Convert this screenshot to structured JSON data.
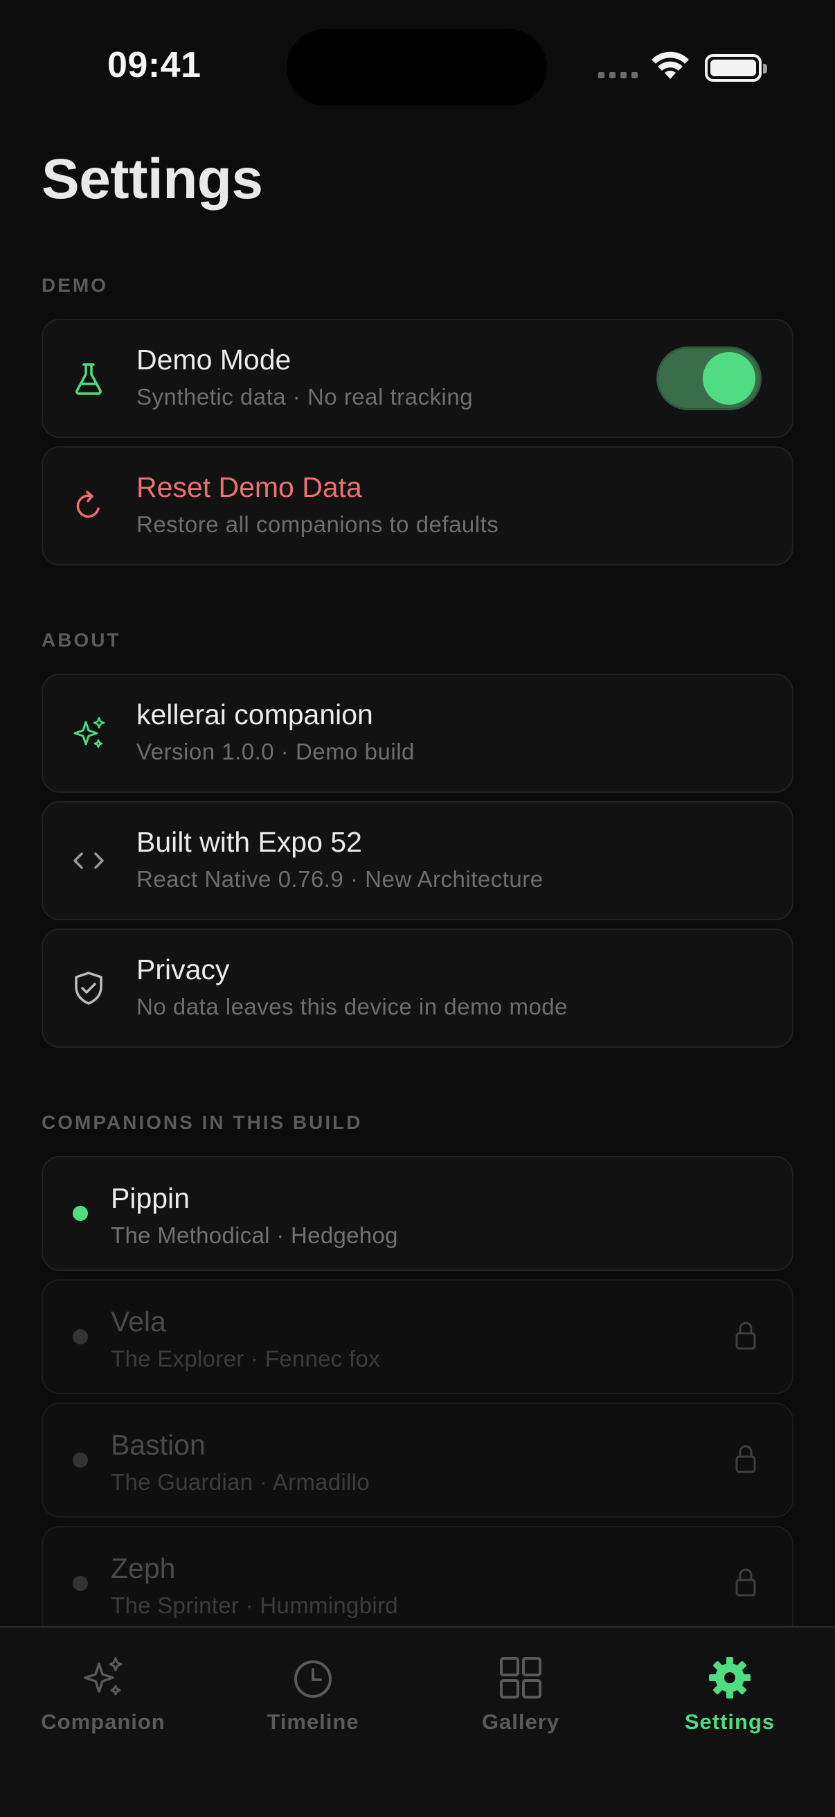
{
  "status_bar": {
    "time": "09:41"
  },
  "page": {
    "title": "Settings"
  },
  "sections": {
    "demo": "DEMO",
    "about": "ABOUT",
    "companions": "COMPANIONS IN THIS BUILD"
  },
  "demo": {
    "demo_mode": {
      "title": "Demo Mode",
      "subtitle": "Synthetic data · No real tracking",
      "icon": "flask-icon",
      "enabled": true
    },
    "reset": {
      "title": "Reset Demo Data",
      "subtitle": "Restore all companions to defaults",
      "icon": "refresh-icon"
    }
  },
  "about": {
    "app": {
      "title": "kellerai companion",
      "subtitle": "Version 1.0.0 · Demo build",
      "icon": "sparkles-icon"
    },
    "built": {
      "title": "Built with Expo 52",
      "subtitle": "React Native 0.76.9 · New Architecture",
      "icon": "code-icon"
    },
    "privacy": {
      "title": "Privacy",
      "subtitle": "No data leaves this device in demo mode",
      "icon": "shield-check-icon"
    }
  },
  "companions": [
    {
      "name": "Pippin",
      "desc": "The Methodical · Hedgehog",
      "locked": false
    },
    {
      "name": "Vela",
      "desc": "The Explorer · Fennec fox",
      "locked": true
    },
    {
      "name": "Bastion",
      "desc": "The Guardian · Armadillo",
      "locked": true
    },
    {
      "name": "Zeph",
      "desc": "The Sprinter · Hummingbird",
      "locked": true
    }
  ],
  "tabs": [
    {
      "label": "Companion",
      "icon": "sparkles-icon",
      "active": false
    },
    {
      "label": "Timeline",
      "icon": "clock-icon",
      "active": false
    },
    {
      "label": "Gallery",
      "icon": "grid-icon",
      "active": false
    },
    {
      "label": "Settings",
      "icon": "gear-icon",
      "active": true
    }
  ],
  "colors": {
    "accent": "#4fdc82",
    "danger": "#ee7070",
    "background": "#0c0c0c",
    "card": "#121212"
  }
}
